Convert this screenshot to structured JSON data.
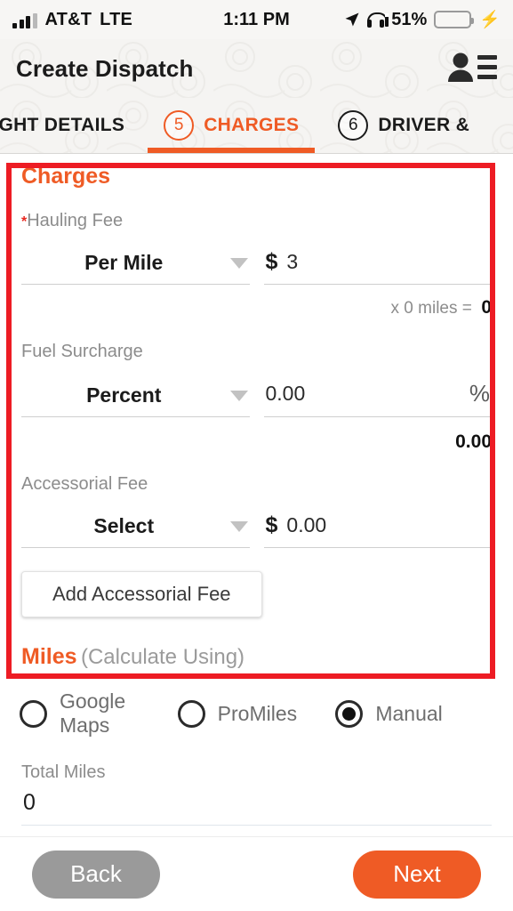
{
  "status_bar": {
    "carrier": "AT&T",
    "network": "LTE",
    "time": "1:11 PM",
    "battery_percent": "51%",
    "battery_level": 51,
    "icons": [
      "signal-bars-icon",
      "location-arrow-icon",
      "headphones-icon",
      "battery-icon",
      "charging-bolt-icon"
    ]
  },
  "header": {
    "title": "Create Dispatch",
    "action_icon": "contacts-list-icon"
  },
  "tabs": [
    {
      "number": "",
      "label": "EIGHT DETAILS",
      "active": false
    },
    {
      "number": "5",
      "label": "CHARGES",
      "active": true
    },
    {
      "number": "6",
      "label": "DRIVER &",
      "active": false
    }
  ],
  "charges": {
    "section_title": "Charges",
    "hauling_fee": {
      "label": "Hauling Fee",
      "required_marker": "*",
      "rate_type": "Per Mile",
      "currency_symbol": "$",
      "amount": "3",
      "calc_text": "x 0 miles =",
      "calc_total": "0"
    },
    "fuel_surcharge": {
      "label": "Fuel Surcharge",
      "rate_type": "Percent",
      "amount": "0.00",
      "suffix": "%",
      "total": "0.00"
    },
    "accessorial_fee": {
      "label": "Accessorial Fee",
      "rate_type": "Select",
      "currency_symbol": "$",
      "amount": "0.00"
    },
    "add_accessorial_label": "Add Accessorial Fee"
  },
  "miles": {
    "section_title": "Miles",
    "section_subtitle": "(Calculate Using)",
    "options": [
      {
        "label": "Google Maps",
        "selected": false
      },
      {
        "label": "ProMiles",
        "selected": false
      },
      {
        "label": "Manual",
        "selected": true
      }
    ],
    "total_miles_label": "Total Miles",
    "total_miles_value": "0"
  },
  "footer": {
    "back_label": "Back",
    "next_label": "Next"
  },
  "colors": {
    "accent_orange": "#ef5b25",
    "annotation_red": "#ed1c24",
    "required_red": "#e8271f",
    "battery_green": "#4cd964",
    "muted_gray": "#8c8c8c",
    "back_gray": "#9a9a9a"
  }
}
